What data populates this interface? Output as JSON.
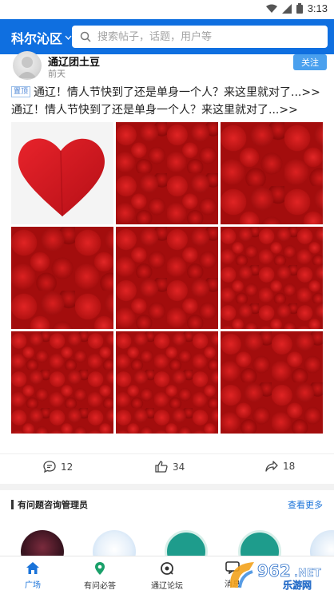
{
  "status_bar": {
    "time": "3:13"
  },
  "topbar": {
    "city": "科尔沁区",
    "search_placeholder": "搜索帖子，话题，用户等",
    "bg_color": "#0f6fe0"
  },
  "post": {
    "author": "通辽团土豆",
    "time": "前天",
    "follow_label": "关注",
    "pin_badge": "置顶",
    "title": "通辽！情人节快到了还是单身一个人？来这里就对了...>>",
    "body": "通辽！情人节快到了还是单身一个人？来这里就对了...>>",
    "images": [
      "heart",
      "roses",
      "roses",
      "roses",
      "roses",
      "roses",
      "roses",
      "roses",
      "roses"
    ],
    "comments": "12",
    "likes": "34",
    "shares": "18"
  },
  "admin_section": {
    "title": "有问题咨询管理员",
    "more_label": "查看更多"
  },
  "tabbar": {
    "items": [
      {
        "label": "广场",
        "icon": "home-icon",
        "active": true
      },
      {
        "label": "有问必答",
        "icon": "location-pin-icon",
        "active": false
      },
      {
        "label": "通辽论坛",
        "icon": "forum-icon",
        "active": false
      },
      {
        "label": "消息",
        "icon": "message-icon",
        "active": false
      }
    ]
  },
  "watermark": {
    "text": "962.net",
    "subtext": "乐游网"
  }
}
